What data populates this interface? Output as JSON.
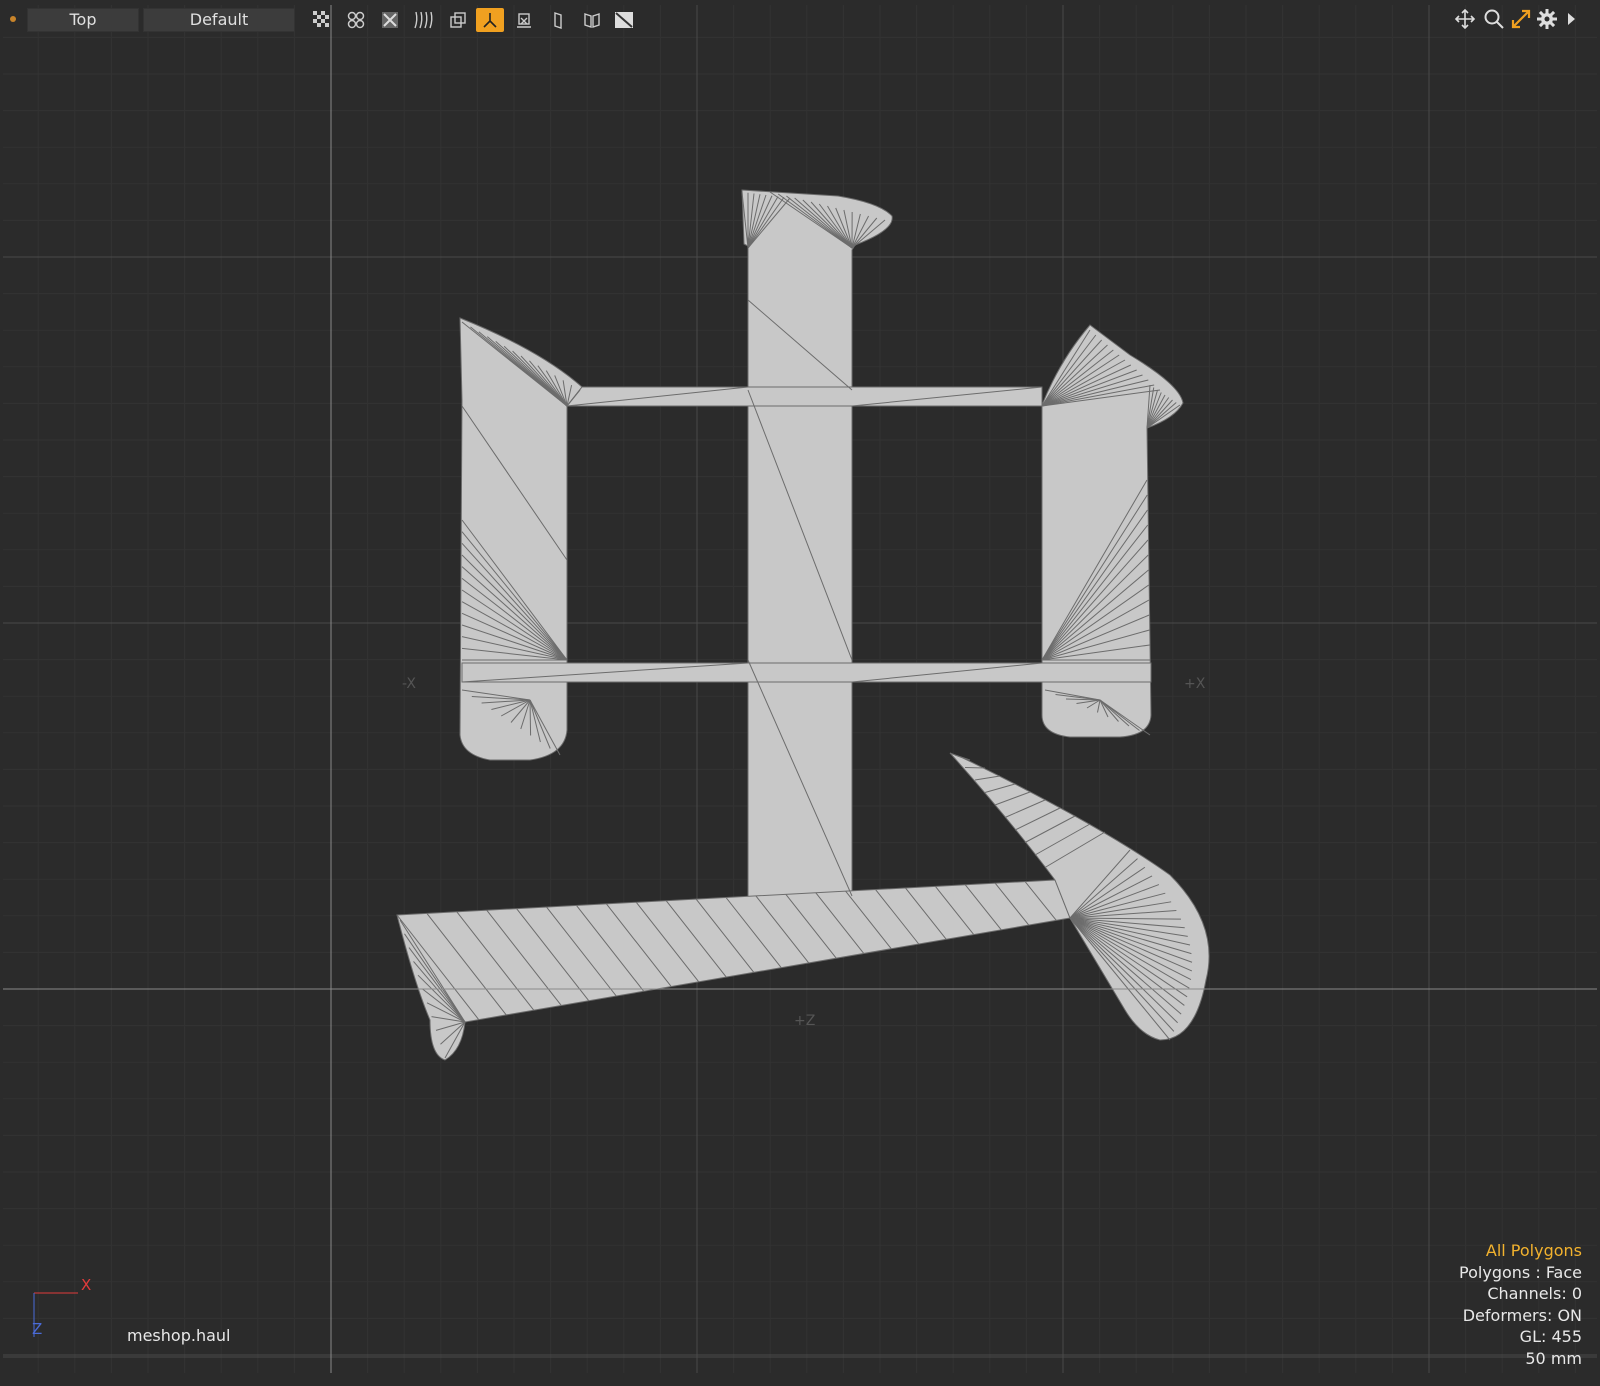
{
  "toolbar": {
    "view_name": "Top",
    "shading_mode": "Default",
    "icons": [
      "checker-icon",
      "grid-toggle-icon",
      "x-ray-icon",
      "wave-icon",
      "copy-view-icon",
      "axis-icon",
      "backdrop-icon",
      "column-icon",
      "book-icon",
      "hatch-icon"
    ],
    "active_icon": "axis-icon",
    "nav_icons": [
      "pan-icon",
      "zoom-icon",
      "fit-icon",
      "gear-icon",
      "more-icon"
    ],
    "accent_color": "#f0a020"
  },
  "viewport": {
    "axis_labels": {
      "neg_x": "-X",
      "pos_x": "+X",
      "pos_z": "+Z"
    },
    "mesh_color": "#c8c8c8",
    "wire_color": "#6c6c6c",
    "background": "#2b2b2b",
    "gizmo": {
      "x_label": "X",
      "z_label": "Z"
    },
    "scene_name": "meshop.haul"
  },
  "info_panel": {
    "selection": "All Polygons",
    "polygons": "Polygons : Face",
    "channels": "Channels: 0",
    "deformers": "Deformers: ON",
    "gl": "GL: 455",
    "grid_size": "50 mm"
  }
}
